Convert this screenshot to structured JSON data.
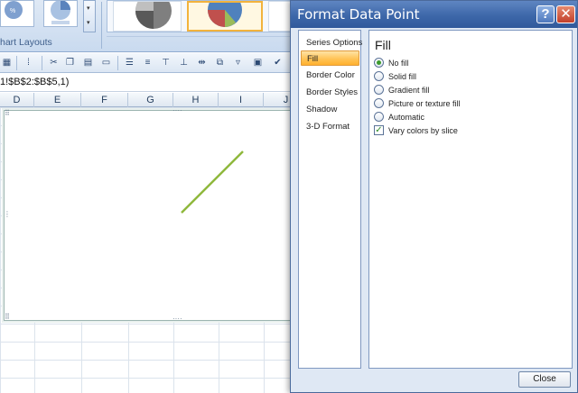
{
  "ribbon": {
    "group_label": "hart Layouts",
    "layout_thumb_caption": "%"
  },
  "formula_bar": {
    "text": "1!$B$2:$B$5,1)"
  },
  "sheet": {
    "columns": [
      "D",
      "E",
      "F",
      "G",
      "H",
      "I",
      "J"
    ]
  },
  "dialog": {
    "title": "Format Data Point",
    "help_label": "?",
    "close_label": "✕",
    "nav": [
      {
        "label": "Series Options",
        "selected": false
      },
      {
        "label": "Fill",
        "selected": true
      },
      {
        "label": "Border Color",
        "selected": false
      },
      {
        "label": "Border Styles",
        "selected": false
      },
      {
        "label": "Shadow",
        "selected": false
      },
      {
        "label": "3-D Format",
        "selected": false
      }
    ],
    "panel_title": "Fill",
    "options": [
      {
        "label": "No fill",
        "type": "radio",
        "checked": true
      },
      {
        "label": "Solid fill",
        "type": "radio",
        "checked": false
      },
      {
        "label": "Gradient fill",
        "type": "radio",
        "checked": false
      },
      {
        "label": "Picture or texture fill",
        "type": "radio",
        "checked": false
      },
      {
        "label": "Automatic",
        "type": "radio",
        "checked": false
      },
      {
        "label": "Vary colors by slice",
        "type": "checkbox",
        "checked": true
      }
    ],
    "close_button": "Close"
  },
  "colors": {
    "title_bar": "#3d67a9",
    "nav_selected": "#ffc457",
    "chart_line": "#8fb83c",
    "pie_blue": "#4f81bd",
    "pie_red": "#c0504d",
    "pie_green": "#9bbb59"
  }
}
